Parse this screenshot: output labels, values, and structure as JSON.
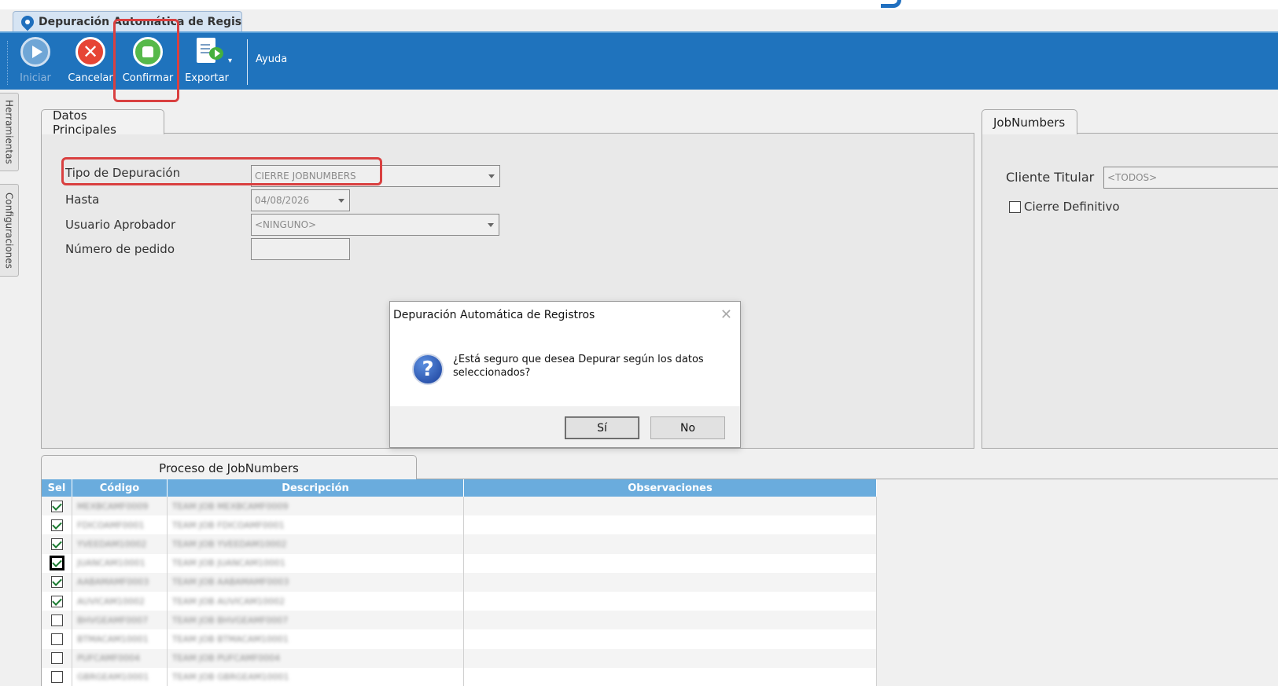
{
  "document_tab": {
    "title": "Depuración Automática de Regis..."
  },
  "ribbon": {
    "buttons": [
      {
        "label": "Iniciar",
        "icon": "play-icon",
        "enabled": false
      },
      {
        "label": "Cancelar",
        "icon": "cancel-icon",
        "enabled": true
      },
      {
        "label": "Confirmar",
        "icon": "thumbs-up-icon",
        "enabled": true
      },
      {
        "label": "Exportar",
        "icon": "export-icon",
        "enabled": true
      }
    ],
    "help_label": "Ayuda"
  },
  "side_tabs": [
    "Herramientas",
    "Configuraciones"
  ],
  "datos_principales": {
    "tab_label": "Datos Principales",
    "tipo_label": "Tipo de Depuración",
    "tipo_value": "CIERRE JOBNUMBERS",
    "hasta_label": "Hasta",
    "hasta_value": "04/08/2026",
    "usuario_label": "Usuario Aprobador",
    "usuario_value": "<NINGUNO>",
    "pedido_label": "Número de pedido",
    "pedido_value": ""
  },
  "jobnumbers": {
    "tab_label": "JobNumbers",
    "cliente_label": "Cliente Titular",
    "cliente_value": "<TODOS>",
    "cierre_label": "Cierre Definitivo",
    "cierre_checked": false
  },
  "dialog": {
    "title": "Depuración Automática de Registros",
    "message": "¿Está seguro que desea Depurar según los datos seleccionados?",
    "yes_label": "Sí",
    "no_label": "No",
    "icon": "question-icon"
  },
  "proceso": {
    "tab_label": "Proceso de JobNumbers",
    "columns": [
      "Sel",
      "Código",
      "Descripción",
      "Observaciones"
    ],
    "rows": [
      {
        "sel": true,
        "codigo": "MEXBCAMF0009",
        "descripcion": "TEAM JOB MEXBCAMF0009",
        "observaciones": ""
      },
      {
        "sel": true,
        "codigo": "FDICOAMF0001",
        "descripcion": "TEAM JOB FDICOAMF0001",
        "observaciones": ""
      },
      {
        "sel": true,
        "codigo": "YVEEDAM10002",
        "descripcion": "TEAM JOB YVEEDAM10002",
        "observaciones": ""
      },
      {
        "sel": true,
        "codigo": "JUANCAM10001",
        "descripcion": "TEAM JOB JUANCAM10001",
        "observaciones": ""
      },
      {
        "sel": true,
        "codigo": "AABAMAMF0003",
        "descripcion": "TEAM JOB AABAMAMF0003",
        "observaciones": ""
      },
      {
        "sel": true,
        "codigo": "AUVICAM10002",
        "descripcion": "TEAM JOB AUVICAM10002",
        "observaciones": ""
      },
      {
        "sel": false,
        "codigo": "BHVGEAMF0007",
        "descripcion": "TEAM JOB BHVGEAMF0007",
        "observaciones": ""
      },
      {
        "sel": false,
        "codigo": "BTMACAM10001",
        "descripcion": "TEAM JOB BTMACAM10001",
        "observaciones": ""
      },
      {
        "sel": false,
        "codigo": "PUFCAMF0004",
        "descripcion": "TEAM JOB PUFCAMF0004",
        "observaciones": ""
      },
      {
        "sel": false,
        "codigo": "GBRGEAM10001",
        "descripcion": "TEAM JOB GBRGEAM10001",
        "observaciones": ""
      }
    ]
  },
  "colors": {
    "ribbon": "#1f73bd",
    "accent_red": "#d94040",
    "grid_header": "#6aacdd"
  }
}
